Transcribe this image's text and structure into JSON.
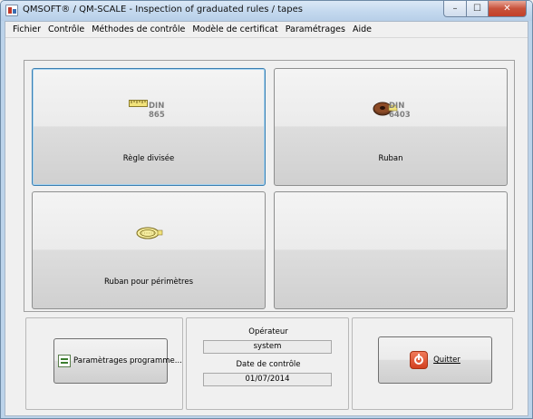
{
  "window": {
    "title": "QMSOFT® / QM-SCALE - Inspection of graduated rules / tapes",
    "buttons": {
      "minimize": "–",
      "maximize": "☐",
      "close": "✕"
    }
  },
  "menu": [
    {
      "label": "Fichier"
    },
    {
      "label": "Contrôle"
    },
    {
      "label": "Méthodes de contrôle"
    },
    {
      "label": "Modèle de certificat"
    },
    {
      "label": "Paramétrages"
    },
    {
      "label": "Aide"
    }
  ],
  "tiles": {
    "regle": {
      "label": "Règle divisée",
      "din_line1": "DIN",
      "din_line2": "865",
      "icon": "ruler-icon"
    },
    "ruban": {
      "label": "Ruban",
      "din_line1": "DIN",
      "din_line2": "6403",
      "icon": "tape-reel-icon"
    },
    "perimetre": {
      "label": "Ruban pour périmètres",
      "icon": "circumference-tape-icon"
    },
    "empty": {
      "label": ""
    }
  },
  "settings_button": {
    "label": "Paramètrages programme...",
    "icon": "settings-list-icon"
  },
  "operator": {
    "label": "Opérateur",
    "value": "system"
  },
  "date": {
    "label": "Date de contrôle",
    "value": "01/07/2014"
  },
  "quit_button": {
    "label": "Quitter",
    "icon": "power-icon"
  },
  "colors": {
    "focus_border": "#3c7fb1",
    "quit_icon": "#d2401f",
    "titlebar": "#c3d8ee"
  }
}
